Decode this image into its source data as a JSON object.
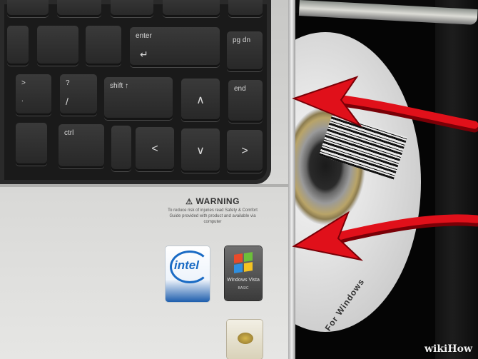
{
  "keys": {
    "enter": "enter",
    "enter_arrow": "↵",
    "pg_dn": "pg dn",
    "end": "end",
    "shift": "shift ↑",
    "ctrl": "ctrl",
    "up": "∧",
    "left": "<",
    "down": "∨",
    "right": ">",
    "question": "?",
    "slash": "/",
    "greater": ">",
    "period": "."
  },
  "warning": {
    "title": "WARNING",
    "body": "To reduce risk of injuries read Safety & Comfort Guide provided with product and available via computer"
  },
  "stickers": {
    "intel": "intel",
    "windows": "Windows Vista",
    "windows_sub": "BASIC"
  },
  "disc": {
    "label_text": "For Windows"
  },
  "watermark": "wikiHow",
  "colors": {
    "arrow": "#e0101a",
    "intel_blue": "#1a6bc4"
  }
}
